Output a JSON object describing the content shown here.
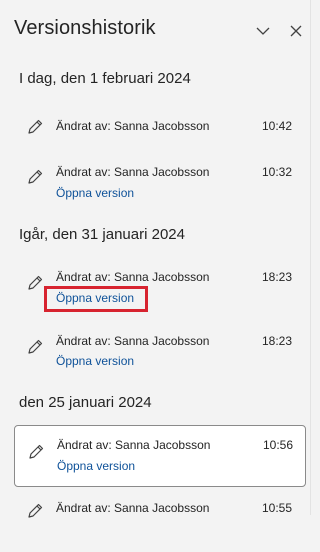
{
  "panel": {
    "title": "Versionshistorik",
    "collapse_icon": "chevron-down-icon",
    "close_icon": "close-icon"
  },
  "groups": [
    {
      "date": "I dag, den 1 februari 2024",
      "versions": [
        {
          "author": "Ändrat av: Sanna Jacobsson",
          "time": "10:42",
          "open_label": ""
        },
        {
          "author": "Ändrat av: Sanna Jacobsson",
          "time": "10:32",
          "open_label": "Öppna version"
        }
      ]
    },
    {
      "date": "Igår, den 31 januari 2024",
      "versions": [
        {
          "author": "Ändrat av: Sanna Jacobsson",
          "time": "18:23",
          "open_label": "Öppna version"
        },
        {
          "author": "Ändrat av: Sanna Jacobsson",
          "time": "18:23",
          "open_label": "Öppna version"
        }
      ]
    },
    {
      "date": "den 25 januari 2024",
      "versions": [
        {
          "author": "Ändrat av: Sanna Jacobsson",
          "time": "10:56",
          "open_label": "Öppna version"
        },
        {
          "author": "Ändrat av: Sanna Jacobsson",
          "time": "10:55",
          "open_label": ""
        }
      ]
    }
  ],
  "colors": {
    "link": "#0f5299",
    "highlight": "#d7232f",
    "panel_bg": "#f3f3f3"
  }
}
